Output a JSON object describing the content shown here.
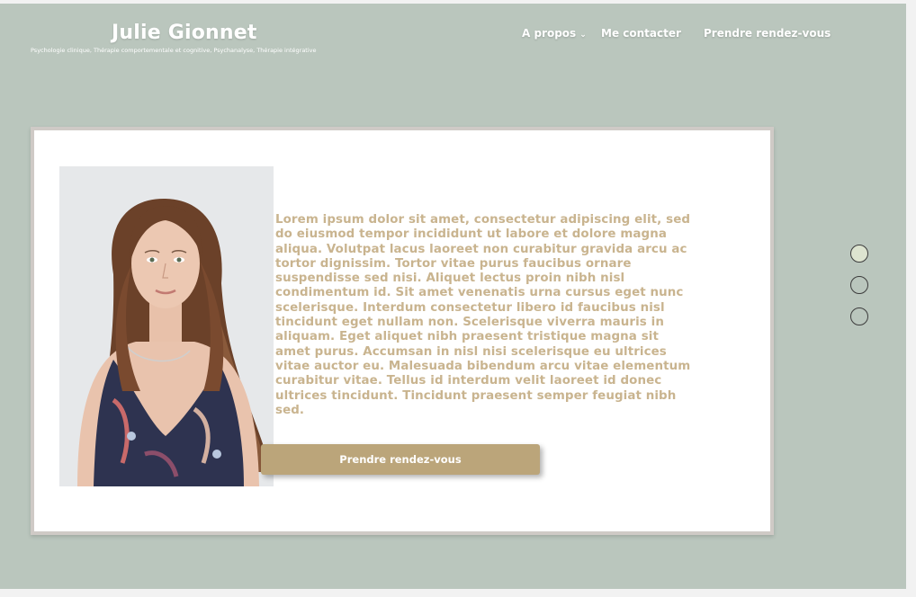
{
  "site": {
    "title": "Julie Gionnet",
    "tagline": "Psychologie clinique, Thérapie comportementale et cognitive, Psychanalyse, Thérapie intégrative"
  },
  "nav": {
    "items": [
      {
        "label": "A propos",
        "has_dropdown": true,
        "icon": "chevron-down-icon"
      },
      {
        "label": "Me contacter"
      },
      {
        "label": "Prendre rendez-vous"
      }
    ]
  },
  "hero": {
    "body": "Lorem ipsum dolor sit amet, consectetur adipiscing elit, sed do eiusmod tempor incididunt ut labore et dolore magna aliqua. Volutpat lacus laoreet non curabitur gravida arcu ac tortor dignissim. Tortor vitae purus faucibus ornare suspendisse sed nisi. Aliquet lectus proin nibh nisl condimentum id. Sit amet venenatis urna cursus eget nunc scelerisque. Interdum consectetur libero id faucibus nisl tincidunt eget nullam non. Scelerisque viverra mauris in aliquam. Eget aliquet nibh praesent tristique magna sit amet purus. Accumsan in nisl nisi scelerisque eu ultrices vitae auctor eu. Malesuada bibendum arcu vitae elementum curabitur vitae. Tellus id interdum velit laoreet id donec ultrices tincidunt. Tincidunt praesent semper feugiat nibh sed.",
    "cta_label": "Prendre rendez-vous"
  },
  "slider": {
    "active_index": 0
  },
  "colors": {
    "background": "#bac6bd",
    "text_accent": "#c9b48f",
    "button": "#bba57a"
  }
}
